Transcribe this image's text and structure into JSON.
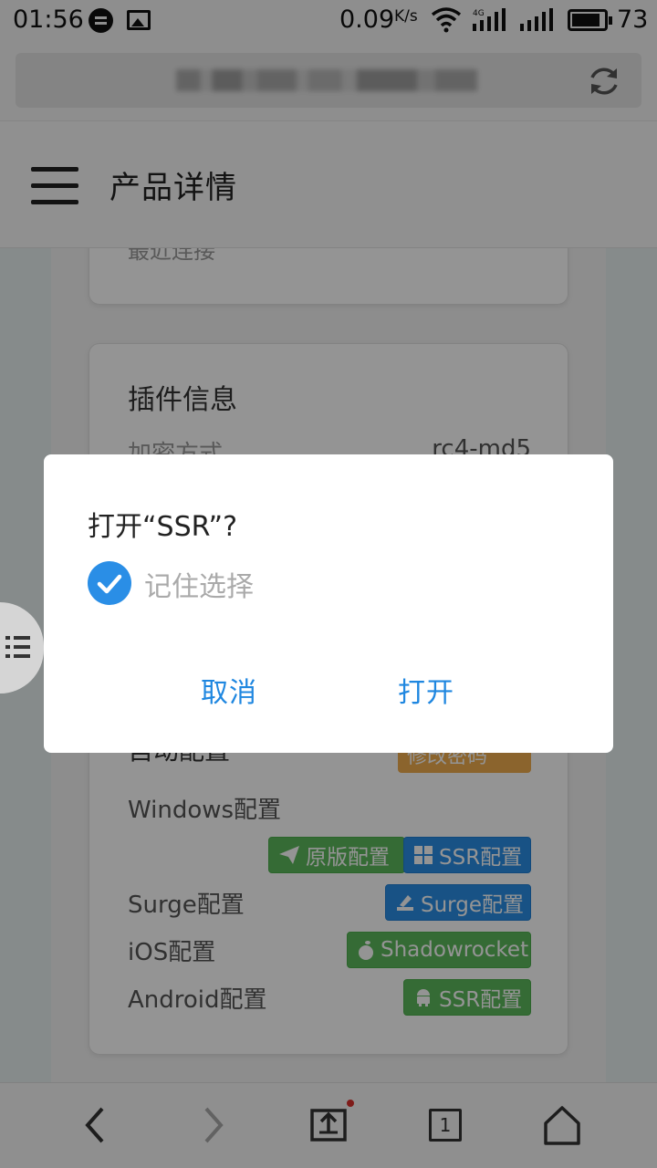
{
  "status_bar": {
    "time": "01:56",
    "net_speed": "0.09",
    "net_speed_unit": "K/s",
    "network_type": "4G",
    "battery": "73"
  },
  "header": {
    "title": "产品详情"
  },
  "card_top": {
    "partial_text": "最近连接"
  },
  "plugin_card": {
    "title": "插件信息",
    "encryption_label": "加密方式",
    "encryption_value": "rc4-md5",
    "auto_config_label": "自动配置",
    "reset_port_label": "修改密码",
    "rows": [
      {
        "label": "Windows配置",
        "buttons": [
          {
            "text": "原版配置",
            "icon": "paper-plane-icon",
            "color": "#5cb85c"
          },
          {
            "text": "SSR配置",
            "icon": "windows-icon",
            "color": "#2a8ee6"
          }
        ]
      },
      {
        "label": "Surge配置",
        "buttons": [
          {
            "text": "Surge配置",
            "icon": "surge-icon",
            "color": "#2a8ee6"
          }
        ]
      },
      {
        "label": "iOS配置",
        "buttons": [
          {
            "text": "Shadowrocket",
            "icon": "apple-icon",
            "color": "#5cb85c"
          }
        ]
      },
      {
        "label": "Android配置",
        "buttons": [
          {
            "text": "SSR配置",
            "icon": "android-icon",
            "color": "#5cb85c"
          }
        ]
      }
    ]
  },
  "dialog": {
    "title": "打开“SSR”?",
    "remember_label": "记住选择",
    "remember_checked": true,
    "cancel_label": "取消",
    "open_label": "打开"
  },
  "bottom_nav": {
    "tab_count": "1"
  },
  "colors": {
    "accent_blue": "#2a8ee6",
    "button_green": "#5cb85c",
    "warning_orange": "#f0ad4e"
  }
}
